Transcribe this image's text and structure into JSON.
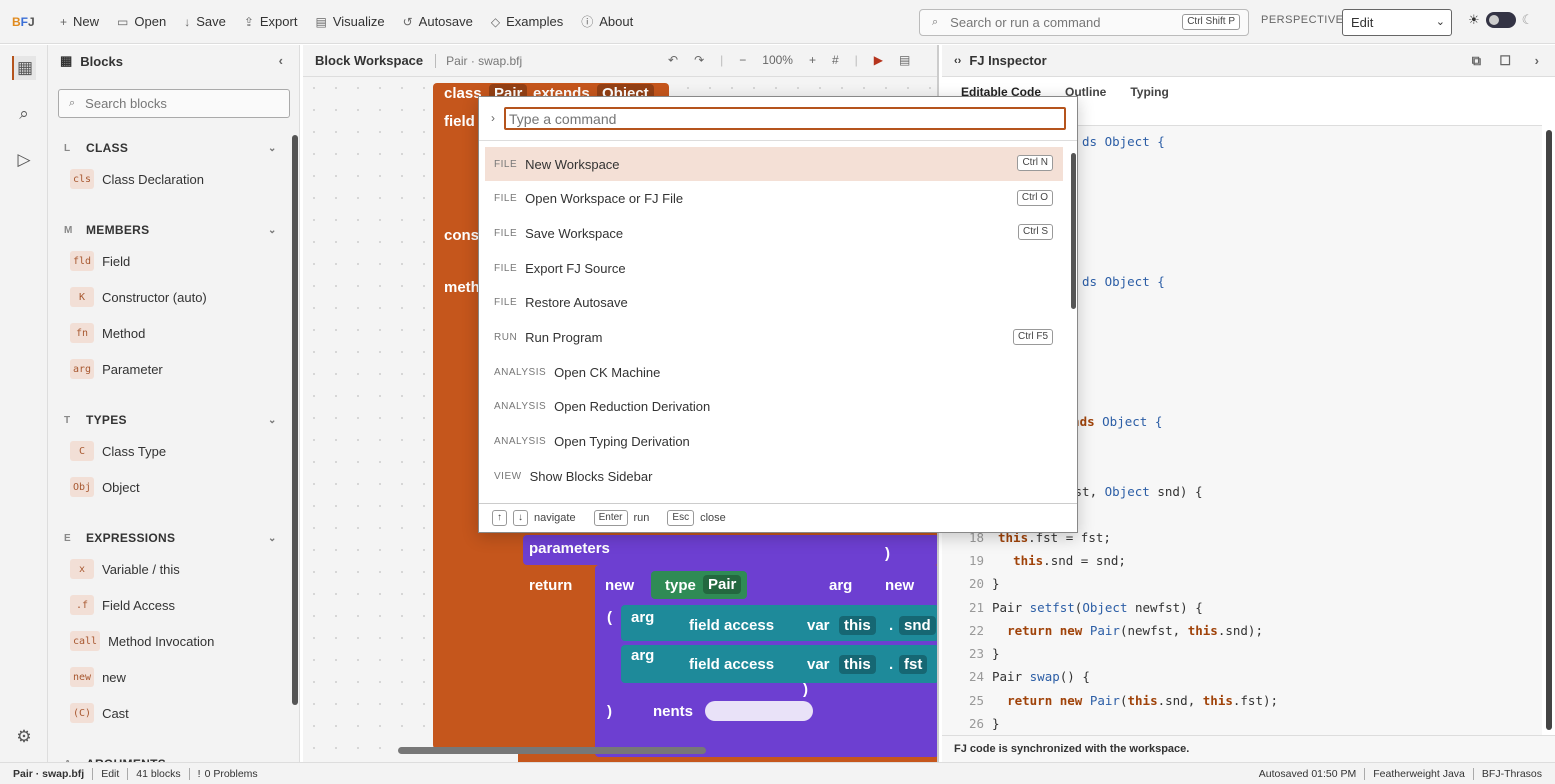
{
  "topbar": {
    "menu": [
      {
        "icon": "plus-icon",
        "label": "New"
      },
      {
        "icon": "folder-icon",
        "label": "Open"
      },
      {
        "icon": "download-icon",
        "label": "Save"
      },
      {
        "icon": "export-icon",
        "label": "Export"
      },
      {
        "icon": "table-icon",
        "label": "Visualize"
      },
      {
        "icon": "history-icon",
        "label": "Autosave"
      },
      {
        "icon": "diamond-icon",
        "label": "Examples"
      },
      {
        "icon": "info-icon",
        "label": "About"
      }
    ],
    "search_placeholder": "Search or run a command",
    "search_shortcut": "Ctrl Shift P",
    "perspective_label": "PERSPECTIVE",
    "perspective_value": "Edit"
  },
  "sidebar": {
    "title": "Blocks",
    "search_placeholder": "Search blocks",
    "sections": [
      {
        "letter": "L",
        "name": "CLASS",
        "items": [
          {
            "chip": "cls",
            "label": "Class Declaration"
          }
        ]
      },
      {
        "letter": "M",
        "name": "MEMBERS",
        "items": [
          {
            "chip": "fld",
            "label": "Field"
          },
          {
            "chip": "K",
            "label": "Constructor (auto)"
          },
          {
            "chip": "fn",
            "label": "Method"
          },
          {
            "chip": "arg",
            "label": "Parameter"
          }
        ]
      },
      {
        "letter": "T",
        "name": "TYPES",
        "items": [
          {
            "chip": "C",
            "label": "Class Type"
          },
          {
            "chip": "Obj",
            "label": "Object"
          }
        ]
      },
      {
        "letter": "E",
        "name": "EXPRESSIONS",
        "items": [
          {
            "chip": "x",
            "label": "Variable / this"
          },
          {
            "chip": ".f",
            "label": "Field Access"
          },
          {
            "chip": "call",
            "label": "Method Invocation"
          },
          {
            "chip": "new",
            "label": "new"
          },
          {
            "chip": "(C)",
            "label": "Cast"
          }
        ]
      },
      {
        "letter": "A",
        "name": "ARGUMENTS",
        "items": []
      }
    ]
  },
  "workspace": {
    "title": "Block Workspace",
    "file": "Pair · swap.bfj",
    "zoom": "100%",
    "blocks": {
      "class_kw": "class",
      "class_name": "Pair",
      "extends_kw": "extends",
      "super_name": "Object",
      "field_kw": "field",
      "cons_kw": "cons",
      "meth_kw": "meth",
      "parameters": "parameters",
      "return_kw": "return",
      "new_kw": "new",
      "type_kw": "type",
      "type_name": "Pair",
      "arg1": "arg",
      "arg2": "arg",
      "arg3": "arg",
      "new2": "new",
      "paren_open": "(",
      "field_access": "field access",
      "var_kw": "var",
      "this_kw": "this",
      "dot": ".",
      "snd": "snd",
      "fst": "fst",
      "paren_close": ")",
      "paren_close2": ")",
      "paren_close3": ")",
      "nents": "nents"
    }
  },
  "inspector": {
    "title": "FJ Inspector",
    "tabs": [
      "Editable Code",
      "Outline",
      "Typing"
    ],
    "code_lines": [
      {
        "n": "",
        "parts": [
          [
            "ty",
            "ds Object {"
          ]
        ]
      },
      {
        "n": "",
        "parts": [
          [
            "ty",
            "ds Object {"
          ]
        ]
      },
      {
        "n": "",
        "parts": [
          [
            "kw",
            "tends "
          ],
          [
            "ty",
            "Object {"
          ]
        ]
      },
      {
        "n": "",
        "parts": [
          [
            "",
            "fst, "
          ],
          [
            "ty",
            "Object"
          ],
          [
            "",
            " snd) {"
          ]
        ]
      },
      {
        "n": "18",
        "parts": [
          [
            "",
            ""
          ],
          [
            "kw",
            "this"
          ],
          [
            "",
            ".fst = fst;"
          ]
        ]
      },
      {
        "n": "19",
        "parts": [
          [
            "",
            "  "
          ],
          [
            "kw",
            "this"
          ],
          [
            "",
            ".snd = snd;"
          ]
        ]
      },
      {
        "n": "20",
        "parts": [
          [
            "",
            "}"
          ]
        ]
      },
      {
        "n": "21",
        "parts": [
          [
            "",
            "Pair "
          ],
          [
            "ty",
            "setfst"
          ],
          [
            "",
            "("
          ],
          [
            "ty",
            "Object"
          ],
          [
            "",
            " newfst) {"
          ]
        ]
      },
      {
        "n": "22",
        "parts": [
          [
            "",
            "  "
          ],
          [
            "kw",
            "return new "
          ],
          [
            "ty",
            "Pair"
          ],
          [
            "",
            "(newfst, "
          ],
          [
            "kw",
            "this"
          ],
          [
            "",
            ".snd);"
          ]
        ]
      },
      {
        "n": "23",
        "parts": [
          [
            "",
            "}"
          ]
        ]
      },
      {
        "n": "24",
        "parts": [
          [
            "",
            "Pair "
          ],
          [
            "ty",
            "swap"
          ],
          [
            "",
            "() {"
          ]
        ]
      },
      {
        "n": "25",
        "parts": [
          [
            "",
            "  "
          ],
          [
            "kw",
            "return new "
          ],
          [
            "ty",
            "Pair"
          ],
          [
            "",
            "("
          ],
          [
            "kw",
            "this"
          ],
          [
            "",
            ".snd, "
          ],
          [
            "kw",
            "this"
          ],
          [
            "",
            ".fst);"
          ]
        ]
      },
      {
        "n": "26",
        "parts": [
          [
            "",
            "}"
          ]
        ]
      }
    ],
    "footer": "FJ code is synchronized with the workspace."
  },
  "palette": {
    "placeholder": "Type a command",
    "items": [
      {
        "cat": "FILE",
        "label": "New Workspace",
        "key": "Ctrl N",
        "selected": true
      },
      {
        "cat": "FILE",
        "label": "Open Workspace or FJ File",
        "key": "Ctrl O"
      },
      {
        "cat": "FILE",
        "label": "Save Workspace",
        "key": "Ctrl S"
      },
      {
        "cat": "FILE",
        "label": "Export FJ Source",
        "key": ""
      },
      {
        "cat": "FILE",
        "label": "Restore Autosave",
        "key": ""
      },
      {
        "cat": "RUN",
        "label": "Run Program",
        "key": "Ctrl F5"
      },
      {
        "cat": "ANALYSIS",
        "label": "Open CK Machine",
        "key": ""
      },
      {
        "cat": "ANALYSIS",
        "label": "Open Reduction Derivation",
        "key": ""
      },
      {
        "cat": "ANALYSIS",
        "label": "Open Typing Derivation",
        "key": ""
      },
      {
        "cat": "VIEW",
        "label": "Show Blocks Sidebar",
        "key": ""
      }
    ],
    "footer": {
      "up": "↑",
      "down": "↓",
      "navigate": "navigate",
      "enter": "Enter",
      "run": "run",
      "esc": "Esc",
      "close": "close"
    }
  },
  "status": {
    "file": "Pair · swap.bfj",
    "mode": "Edit",
    "blocks": "41 blocks",
    "problems": "0 Problems",
    "autosaved": "Autosaved 01:50 PM",
    "language": "Featherweight Java",
    "brand": "BFJ-Thrasos"
  },
  "colors": {
    "accent": "#b5541d",
    "class_block": "#c5561c",
    "method_block": "#6d3fd1",
    "expr_block": "#1e8a9a",
    "type_block": "#2f8b55"
  }
}
